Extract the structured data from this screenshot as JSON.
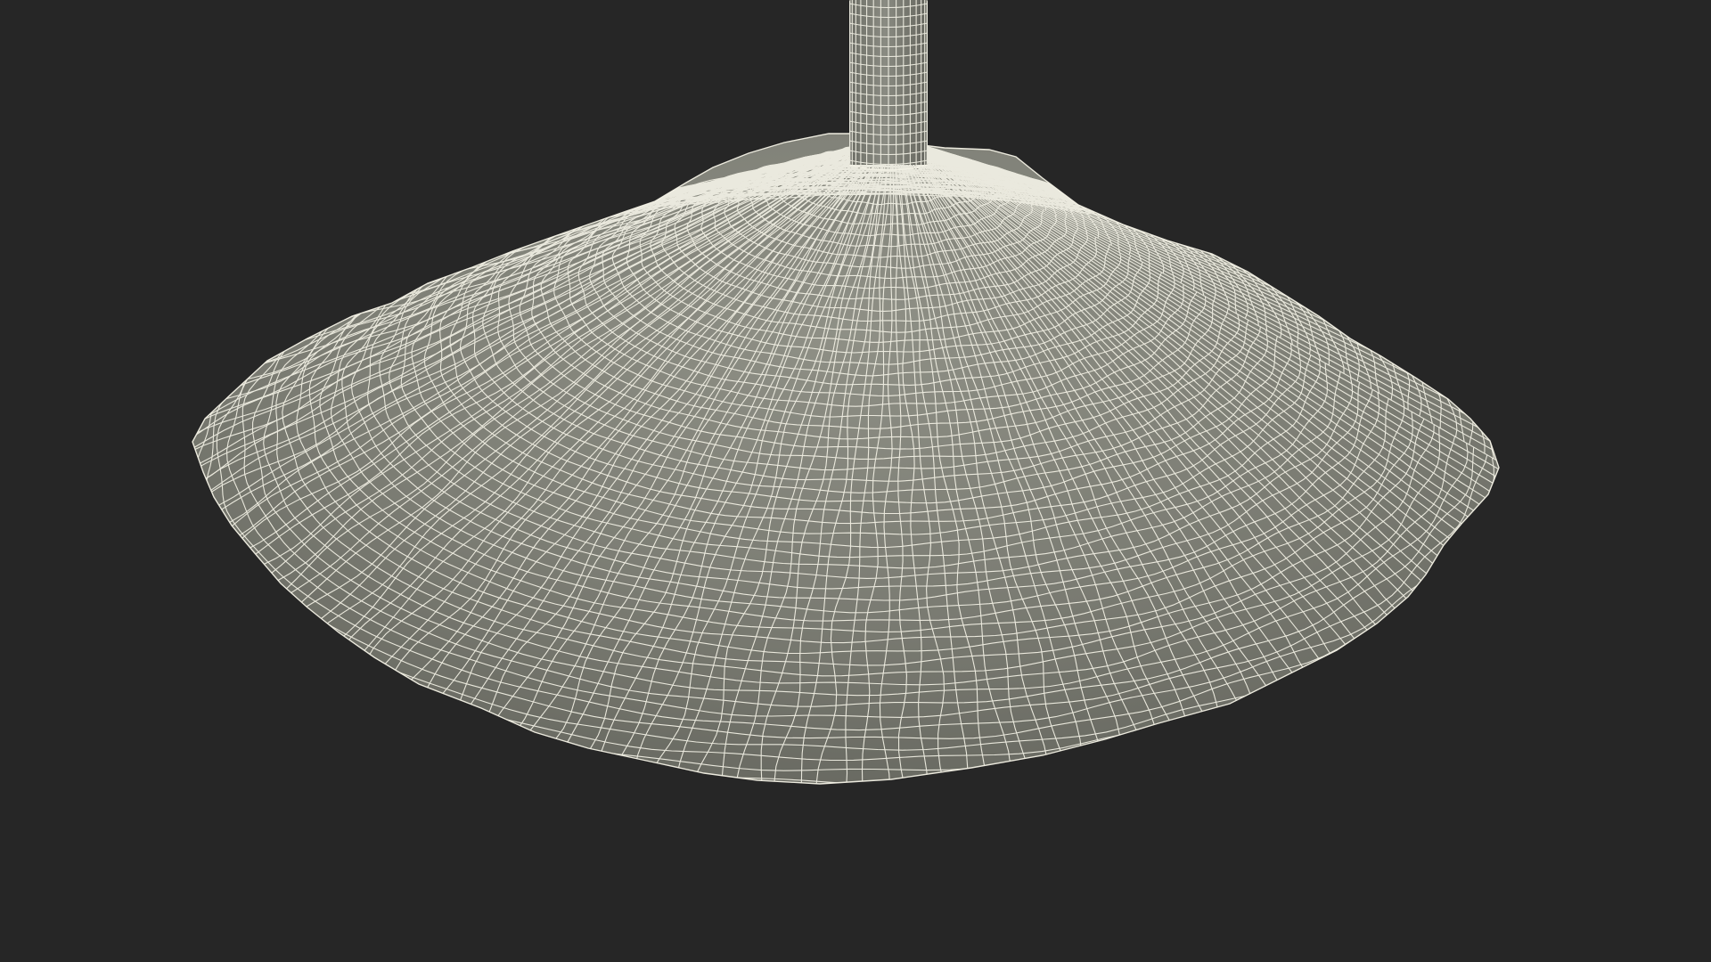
{
  "scene": {
    "background_color": "#262626",
    "mesh_fill_color": "#7c7d74",
    "mesh_fill_highlight": "#8f9086",
    "mesh_wire_color": "#f4f2e6",
    "display_mode": "wireframe-on-shaded",
    "objects": [
      {
        "name": "powder-stream",
        "shape": "cylinder"
      },
      {
        "name": "powder-pile",
        "shape": "cone-heap"
      }
    ]
  }
}
